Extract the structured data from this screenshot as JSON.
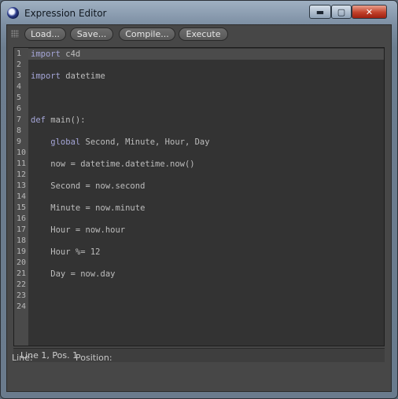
{
  "window": {
    "title": "Expression Editor",
    "minimize_glyph": "▬",
    "maximize_glyph": "▢",
    "close_glyph": "✕"
  },
  "toolbar": {
    "load_label": "Load...",
    "save_label": "Save...",
    "compile_label": "Compile...",
    "execute_label": "Execute"
  },
  "editor": {
    "line_numbers": [
      "1",
      "2",
      "3",
      "4",
      "5",
      "6",
      "7",
      "8",
      "9",
      "10",
      "11",
      "12",
      "13",
      "14",
      "15",
      "16",
      "17",
      "18",
      "19",
      "20",
      "21",
      "22",
      "23",
      "24"
    ],
    "lines": [
      {
        "kw": "import",
        "rest": " c4d"
      },
      {
        "kw": "",
        "rest": ""
      },
      {
        "kw": "import",
        "rest": " datetime"
      },
      {
        "kw": "",
        "rest": ""
      },
      {
        "kw": "",
        "rest": ""
      },
      {
        "kw": "",
        "rest": ""
      },
      {
        "kw": "def",
        "rest": " main():"
      },
      {
        "kw": "",
        "rest": ""
      },
      {
        "kw": "    global",
        "rest": " Second, Minute, Hour, Day"
      },
      {
        "kw": "",
        "rest": ""
      },
      {
        "kw": "",
        "rest": "    now = datetime.datetime.now()"
      },
      {
        "kw": "",
        "rest": ""
      },
      {
        "kw": "",
        "rest": "    Second = now.second"
      },
      {
        "kw": "",
        "rest": ""
      },
      {
        "kw": "",
        "rest": "    Minute = now.minute"
      },
      {
        "kw": "",
        "rest": ""
      },
      {
        "kw": "",
        "rest": "    Hour = now.hour"
      },
      {
        "kw": "",
        "rest": ""
      },
      {
        "kw": "",
        "rest": "    Hour %= 12"
      },
      {
        "kw": "",
        "rest": ""
      },
      {
        "kw": "",
        "rest": "    Day = now.day"
      },
      {
        "kw": "",
        "rest": ""
      },
      {
        "kw": "",
        "rest": ""
      },
      {
        "kw": "",
        "rest": ""
      }
    ]
  },
  "status_bar": {
    "cursor": "Line 1, Pos. 1"
  },
  "footer": {
    "line_label": "Line:",
    "position_label": "Position:"
  }
}
